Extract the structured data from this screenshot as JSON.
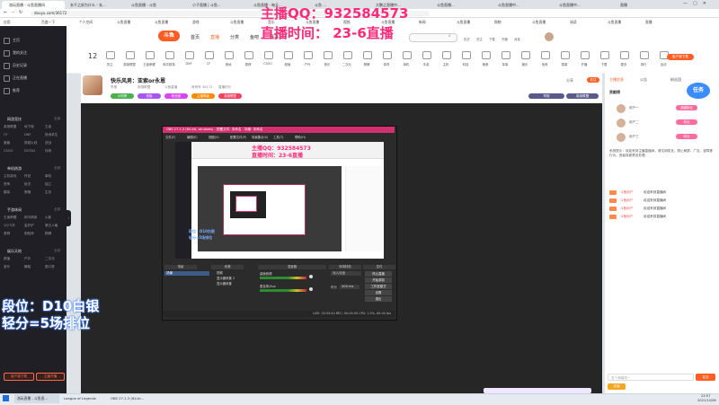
{
  "browser": {
    "tabs": [
      {
        "label": "洛玩直播 - 斗鱼直播间",
        "active": true
      },
      {
        "label": "玄千之前为什么 - 玄...",
        "active": false
      },
      {
        "label": "斗鱼直播 - 斗鱼",
        "active": false
      },
      {
        "label": "小子直播 | 斗鱼...",
        "active": false
      },
      {
        "label": "斗鱼直播 - 每天...",
        "active": false
      },
      {
        "label": "斗鱼 ...",
        "active": false
      },
      {
        "label": "大鹏之直播中...",
        "active": false
      },
      {
        "label": "斗鱼直播...",
        "active": false
      },
      {
        "label": "斗鱼直播中...",
        "active": false
      },
      {
        "label": "斗鱼直播中...",
        "active": false
      },
      {
        "label": "直播",
        "active": false
      }
    ],
    "url": "douyu.com/36172",
    "bookmarks": [
      "应用",
      "百度一下",
      "个人空间",
      "斗鱼直播",
      "斗鱼直播",
      "游戏",
      "斗鱼直播",
      "音乐",
      "斗鱼直播",
      "视频",
      "斗鱼直播",
      "新闻",
      "斗鱼直播",
      "购物",
      "斗鱼直播",
      "阅读",
      "斗鱼直播",
      "直播"
    ]
  },
  "overlay": {
    "qq": "主播QQ：932584573",
    "time": "直播时间：  23-6直播",
    "rank": "段位：D10白银",
    "points": "轻分=5场排位",
    "inner_qq": "主播QQ：932584573",
    "inner_time": "直播时间：23-6直播",
    "inner_rank": "段位：D10白银",
    "inner_points": "轻分=5场排位"
  },
  "sidebar": {
    "top_items": [
      "主页",
      "我的关注",
      "历史记录",
      "正在直播",
      "推荐"
    ],
    "follow_count": "12",
    "sections": [
      {
        "title": "网游竞技",
        "more": "全部",
        "items": [
          "英雄联盟",
          "地下城",
          "王者",
          "CF",
          "DNF",
          "绝地求生",
          "魔兽",
          "穿越火线",
          "逆战",
          "CSGO",
          "DOTA2",
          "传奇"
        ]
      },
      {
        "title": "单机热游",
        "more": "全部",
        "items": [
          "主机游戏",
          "怀旧",
          "单机",
          "恐怖",
          "射击",
          "独立",
          "模拟",
          "策略",
          "生存"
        ]
      },
      {
        "title": "手游休闲",
        "more": "全部",
        "items": [
          "王者荣耀",
          "和平精英",
          "火影",
          "QQ飞车",
          "金铲铲",
          "第五人格",
          "原神",
          "阴阳师",
          "棋牌"
        ]
      },
      {
        "title": "娱乐天地",
        "more": "全部",
        "items": [
          "颜值",
          "户外",
          "二次元",
          "音乐",
          "舞蹈",
          "脱口秀"
        ]
      }
    ],
    "bottom_button_1": "客户端下载",
    "bottom_button_2": "主播开播"
  },
  "header": {
    "logo": "斗鱼",
    "nav": [
      "首页",
      "直播",
      "分类",
      "鱼吧",
      "赛事"
    ],
    "search_placeholder": "搜索主播或直播间",
    "user_icons": [
      "历史",
      "关注",
      "下载",
      "开播",
      "消息"
    ]
  },
  "categories": [
    "关注",
    "英雄联盟",
    "王者荣耀",
    "和平精英",
    "DNF",
    "CF",
    "绝地",
    "原神",
    "CSGO",
    "颜值",
    "户外",
    "音乐",
    "二次元",
    "棋牌",
    "体育",
    "单机",
    "手游",
    "主机",
    "科技",
    "美食",
    "军事",
    "娱乐",
    "电竞",
    "赛事",
    "开播",
    "下载",
    "更多",
    "排行",
    "活动"
  ],
  "room": {
    "title": "快乐风男：亚索or永恩",
    "meta": [
      "举报",
      "英雄联盟",
      "斗鱼直播",
      "房间号 36172",
      "直播时长"
    ],
    "follow_btn": "关注",
    "tags": [
      "小时榜",
      "贵族",
      "粉丝团",
      "主播等级",
      "英雄联盟"
    ],
    "share": "分享"
  },
  "chat": {
    "tabs": [
      "主播信息",
      "公告",
      "粉丝团"
    ],
    "rank_title": "贡献榜",
    "fans": [
      {
        "name": "用户一",
        "badge": "超级粉丝"
      },
      {
        "name": "用户二",
        "badge": "粉丝"
      },
      {
        "name": "用户三",
        "badge": "粉丝"
      }
    ],
    "notice": "系统提示：欢迎来到主播直播间，请文明发言，禁止刷屏、广告、谩骂等行为，违者将被禁言处理。",
    "messages": [
      {
        "user": "斗鱼用户",
        "text": "欢迎来到直播间"
      },
      {
        "user": "斗鱼用户",
        "text": "欢迎来到直播间"
      },
      {
        "user": "斗鱼用户",
        "text": "欢迎来到直播间"
      },
      {
        "user": "斗鱼用户",
        "text": "欢迎来到直播间"
      }
    ],
    "input_placeholder": "发个弹幕呗~",
    "send": "发送",
    "recharge": "充值"
  },
  "obs": {
    "title": "OBS 27.1.3 (64-bit, windows) - 配置文件: 未命名 - 场景: 未命名",
    "menu": [
      "文件(F)",
      "编辑(E)",
      "视图(V)",
      "配置文件(P)",
      "场景集合(S)",
      "工具(T)",
      "帮助(H)"
    ],
    "panels": [
      "场景",
      "来源",
      "混音器",
      "转场特效",
      "控件"
    ],
    "scene": "场景",
    "sources": [
      "视频",
      "显示器采集 2",
      "显示器采集"
    ],
    "mixer": [
      "桌面音频",
      "麦克风/Aux"
    ],
    "transition": "淡入淡出",
    "duration_label": "时长",
    "duration": "300 ms",
    "controls": [
      "停止直播",
      "开始录制",
      "工作室模式",
      "设置",
      "退出"
    ],
    "status": "LIVE: 02:53:40   REC: 00:00:00   CPU: 1.5%, 60.00 fps"
  },
  "taskbar": {
    "items": [
      "洛玩直播 - 斗鱼直...",
      "League of Legends",
      "OBS 27.1.3 (64-bi..."
    ],
    "time": "23:57",
    "date": "2021/10/06"
  },
  "colors": {
    "brand": "#ff5d23",
    "overlay_text": "#ff2a7a",
    "sidebar_bg": "#1f1f25",
    "player_bg": "#262626",
    "obs_title": "#d2306e"
  }
}
